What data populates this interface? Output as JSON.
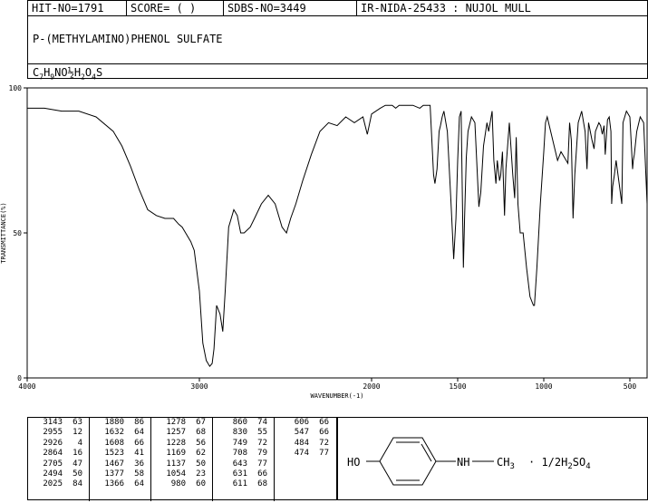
{
  "header": {
    "hit_no": "HIT-NO=1791",
    "score": "SCORE=  (   )",
    "sdbs_no": "SDBS-NO=3449",
    "ir": "IR-NIDA-25433 : NUJOL MULL"
  },
  "compound": {
    "name": "P-(METHYLAMINO)PHENOL SULFATE",
    "formula_parts": [
      "C",
      "7",
      "H",
      "9",
      "NO",
      "½",
      "H",
      "2",
      "O",
      "4",
      "S"
    ]
  },
  "chart_data": {
    "type": "line",
    "xlabel": "WAVENUMBER(-1)",
    "ylabel": "TRANSMITTANCE(%)",
    "xlim": [
      4000,
      400
    ],
    "ylim": [
      0,
      100
    ],
    "xticks": [
      4000,
      3000,
      2000,
      1500,
      1000,
      500
    ],
    "yticks": [
      0,
      50,
      100
    ],
    "series": [
      {
        "x": [
          4000,
          3900,
          3800,
          3700,
          3600,
          3500,
          3450,
          3400,
          3350,
          3300,
          3250,
          3200,
          3150,
          3120,
          3100,
          3080,
          3050,
          3030,
          3000,
          2980,
          2960,
          2940,
          2926,
          2915,
          2900,
          2880,
          2864,
          2850,
          2830,
          2800,
          2780,
          2760,
          2740,
          2705,
          2680,
          2640,
          2600,
          2560,
          2520,
          2494,
          2470,
          2440,
          2400,
          2350,
          2300,
          2250,
          2200,
          2150,
          2100,
          2050,
          2025,
          2000,
          1950,
          1920,
          1900,
          1880,
          1860,
          1840,
          1800,
          1760,
          1720,
          1700,
          1680,
          1660,
          1640,
          1632,
          1620,
          1608,
          1600,
          1590,
          1580,
          1560,
          1540,
          1523,
          1510,
          1500,
          1490,
          1480,
          1467,
          1460,
          1450,
          1440,
          1420,
          1400,
          1377,
          1366,
          1350,
          1330,
          1320,
          1300,
          1290,
          1278,
          1270,
          1257,
          1250,
          1240,
          1228,
          1220,
          1200,
          1180,
          1169,
          1160,
          1150,
          1137,
          1120,
          1100,
          1080,
          1060,
          1054,
          1040,
          1020,
          1000,
          990,
          980,
          960,
          940,
          920,
          900,
          880,
          860,
          850,
          840,
          830,
          820,
          800,
          780,
          760,
          749,
          740,
          720,
          708,
          700,
          680,
          670,
          660,
          650,
          643,
          630,
          620,
          610,
          606,
          600,
          590,
          580,
          560,
          547,
          540,
          520,
          500,
          484,
          480,
          474,
          460,
          440,
          420,
          400
        ],
        "y": [
          93,
          93,
          92,
          92,
          90,
          85,
          80,
          73,
          65,
          58,
          56,
          55,
          55,
          53,
          52,
          50,
          47,
          44,
          30,
          12,
          6,
          4,
          5,
          10,
          25,
          22,
          16,
          30,
          52,
          58,
          56,
          50,
          50,
          52,
          55,
          60,
          63,
          60,
          52,
          50,
          55,
          60,
          68,
          77,
          85,
          88,
          87,
          90,
          88,
          90,
          84,
          91,
          93,
          94,
          94,
          94,
          93,
          94,
          94,
          94,
          93,
          94,
          94,
          94,
          70,
          67,
          72,
          85,
          87,
          90,
          92,
          85,
          62,
          41,
          55,
          75,
          90,
          92,
          38,
          55,
          76,
          85,
          90,
          88,
          59,
          64,
          80,
          88,
          85,
          92,
          75,
          67,
          75,
          68,
          70,
          78,
          56,
          72,
          88,
          70,
          62,
          83,
          60,
          50,
          50,
          38,
          28,
          25,
          25,
          38,
          60,
          78,
          88,
          90,
          85,
          80,
          75,
          78,
          76,
          74,
          88,
          82,
          55,
          70,
          88,
          92,
          85,
          72,
          88,
          82,
          79,
          85,
          88,
          87,
          84,
          87,
          77,
          89,
          90,
          85,
          60,
          66,
          70,
          75,
          66,
          60,
          88,
          92,
          90,
          72,
          75,
          77,
          85,
          90,
          88,
          60
        ]
      }
    ],
    "peak_table": [
      [
        "3143",
        "63"
      ],
      [
        "2955",
        "12"
      ],
      [
        "2926",
        "4"
      ],
      [
        "2864",
        "16"
      ],
      [
        "2705",
        "47"
      ],
      [
        "2494",
        "50"
      ],
      [
        "2025",
        "84"
      ],
      [
        "1880",
        "86"
      ],
      [
        "1632",
        "64"
      ],
      [
        "1608",
        "66"
      ],
      [
        "1523",
        "41"
      ],
      [
        "1467",
        "36"
      ],
      [
        "1377",
        "58"
      ],
      [
        "1366",
        "64"
      ],
      [
        "1278",
        "67"
      ],
      [
        "1257",
        "68"
      ],
      [
        "1228",
        "56"
      ],
      [
        "1169",
        "62"
      ],
      [
        "1137",
        "50"
      ],
      [
        "1054",
        "23"
      ],
      [
        "980",
        "60"
      ],
      [
        "860",
        "74"
      ],
      [
        "830",
        "55"
      ],
      [
        "749",
        "72"
      ],
      [
        "708",
        "79"
      ],
      [
        "643",
        "77"
      ],
      [
        "631",
        "66"
      ],
      [
        "611",
        "68"
      ],
      [
        "606",
        "66"
      ],
      [
        "547",
        "66"
      ],
      [
        "484",
        "72"
      ],
      [
        "474",
        "77"
      ]
    ]
  },
  "structure": {
    "ho": "HO",
    "nh": "NH",
    "ch3": "CH",
    "ch3_sub": "3",
    "salt_prefix": "· 1/2H",
    "salt_sub1": "2",
    "salt_mid": "SO",
    "salt_sub2": "4"
  }
}
